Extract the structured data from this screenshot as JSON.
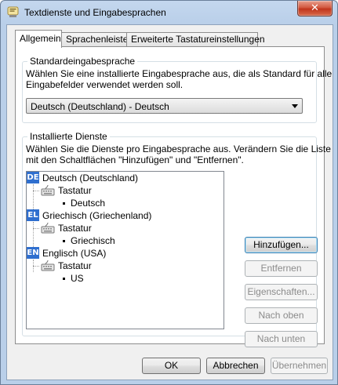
{
  "window": {
    "title": "Textdienste und Eingabesprachen",
    "close_glyph": "✕"
  },
  "tabs": [
    {
      "label": "Allgemein",
      "active": true
    },
    {
      "label": "Sprachenleiste",
      "active": false
    },
    {
      "label": "Erweiterte Tastatureinstellungen",
      "active": false
    }
  ],
  "default_language": {
    "legend": "Standardeingabesprache",
    "description_line1": "Wählen Sie eine installierte Eingabesprache aus, die als Standard für alle",
    "description_line2": "Eingabefelder verwendet werden soll.",
    "selected": "Deutsch (Deutschland) - Deutsch"
  },
  "installed_services": {
    "legend": "Installierte Dienste",
    "description_line1": "Wählen Sie die Dienste pro Eingabesprache aus. Verändern Sie die Liste",
    "description_line2": "mit den Schaltflächen \"Hinzufügen\" und \"Entfernen\".",
    "languages": [
      {
        "code": "DE",
        "name": "Deutsch (Deutschland)",
        "group": "Tastatur",
        "layout": "Deutsch"
      },
      {
        "code": "EL",
        "name": "Griechisch (Griechenland)",
        "group": "Tastatur",
        "layout": "Griechisch"
      },
      {
        "code": "EN",
        "name": "Englisch (USA)",
        "group": "Tastatur",
        "layout": "US"
      }
    ],
    "buttons": {
      "add": "Hinzufügen...",
      "remove": "Entfernen",
      "properties": "Eigenschaften...",
      "move_up": "Nach oben",
      "move_down": "Nach unten"
    }
  },
  "footer": {
    "ok": "OK",
    "cancel": "Abbrechen",
    "apply": "Übernehmen"
  },
  "colors": {
    "language_badge": "#2f6fcf",
    "title_bar": "#b9cfe9",
    "close_button": "#c0351c"
  },
  "icons": {
    "title": "text-services-icon",
    "keyboard": "keyboard-icon",
    "close": "close-icon"
  }
}
